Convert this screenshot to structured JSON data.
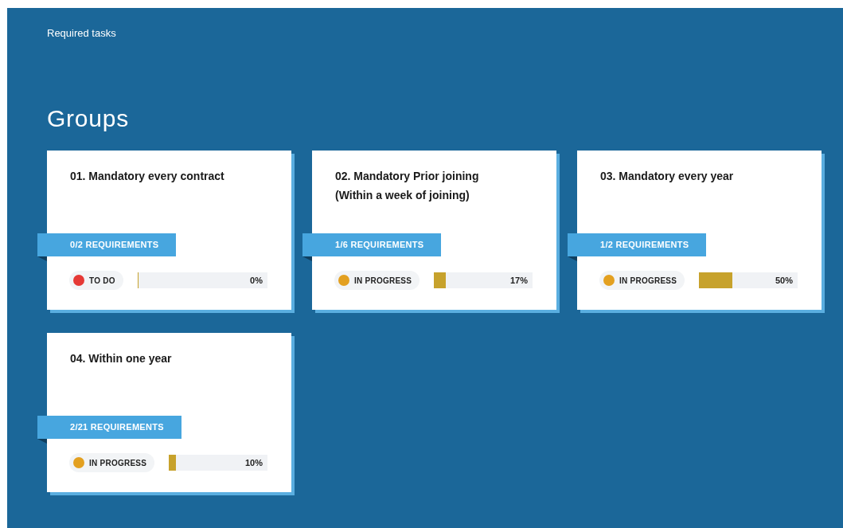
{
  "breadcrumb": "Required tasks",
  "heading": "Groups",
  "groups": [
    {
      "title": "01. Mandatory every contract",
      "requirements": "0/2 REQUIREMENTS",
      "status": {
        "label": "TO DO",
        "color": "#e53935"
      },
      "level": 0,
      "percent": "0%"
    },
    {
      "title": "02. Mandatory Prior joining (Within a week of joining)",
      "requirements": "1/6 REQUIREMENTS",
      "status": {
        "label": "IN PROGRESS",
        "color": "#e3a020"
      },
      "level": 0.12,
      "percent": "17%"
    },
    {
      "title": "03. Mandatory every year",
      "requirements": "1/2 REQUIREMENTS",
      "status": {
        "label": "IN PROGRESS",
        "color": "#e3a020"
      },
      "level": 0.34,
      "percent": "50%"
    },
    {
      "title": "04. Within one year",
      "requirements": "2/21 REQUIREMENTS",
      "status": {
        "label": "IN PROGRESS",
        "color": "#e3a020"
      },
      "level": 0.07,
      "percent": "10%"
    }
  ]
}
